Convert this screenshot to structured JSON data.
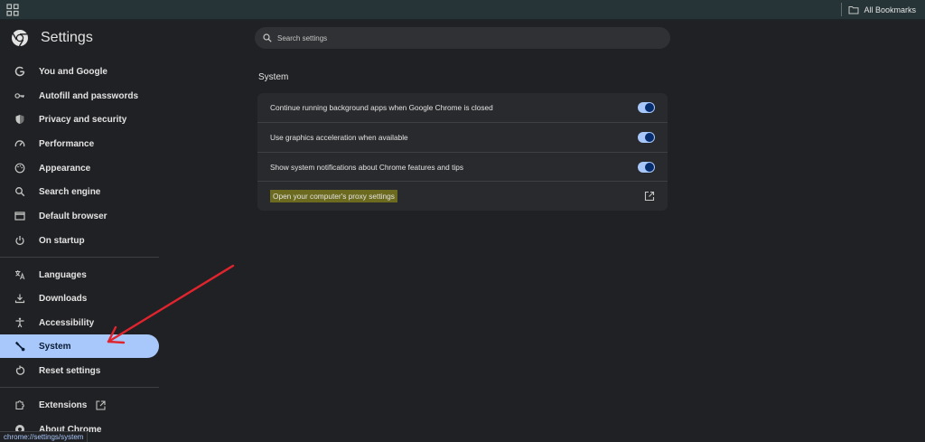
{
  "bookmarks_bar": {
    "all_bookmarks_label": "All Bookmarks"
  },
  "sidebar": {
    "title": "Settings",
    "items": [
      {
        "label": "You and Google",
        "icon": "google-g-icon"
      },
      {
        "label": "Autofill and passwords",
        "icon": "key-icon"
      },
      {
        "label": "Privacy and security",
        "icon": "shield-icon"
      },
      {
        "label": "Performance",
        "icon": "speedometer-icon"
      },
      {
        "label": "Appearance",
        "icon": "palette-icon"
      },
      {
        "label": "Search engine",
        "icon": "search-icon"
      },
      {
        "label": "Default browser",
        "icon": "browser-window-icon"
      },
      {
        "label": "On startup",
        "icon": "power-icon"
      },
      {
        "label": "Languages",
        "icon": "translate-icon"
      },
      {
        "label": "Downloads",
        "icon": "download-icon"
      },
      {
        "label": "Accessibility",
        "icon": "accessibility-icon"
      },
      {
        "label": "System",
        "icon": "wrench-icon",
        "active": true
      },
      {
        "label": "Reset settings",
        "icon": "reset-icon"
      },
      {
        "label": "Extensions",
        "icon": "puzzle-icon"
      },
      {
        "label": "About Chrome",
        "icon": "chrome-icon"
      }
    ]
  },
  "search": {
    "placeholder": "Search settings"
  },
  "main": {
    "section_title": "System",
    "rows": [
      {
        "label": "Continue running background apps when Google Chrome is closed",
        "toggle_on": true
      },
      {
        "label": "Use graphics acceleration when available",
        "toggle_on": true
      },
      {
        "label": "Show system notifications about Chrome features and tips",
        "toggle_on": true
      },
      {
        "label": "Open your computer's proxy settings"
      }
    ]
  },
  "status_bar": {
    "url": "chrome://settings/system"
  },
  "colors": {
    "accent": "#a8c7fa",
    "background": "#202124",
    "card": "#292a2d",
    "annotation_arrow": "#e0242e",
    "highlight": "#6b6a1e"
  }
}
